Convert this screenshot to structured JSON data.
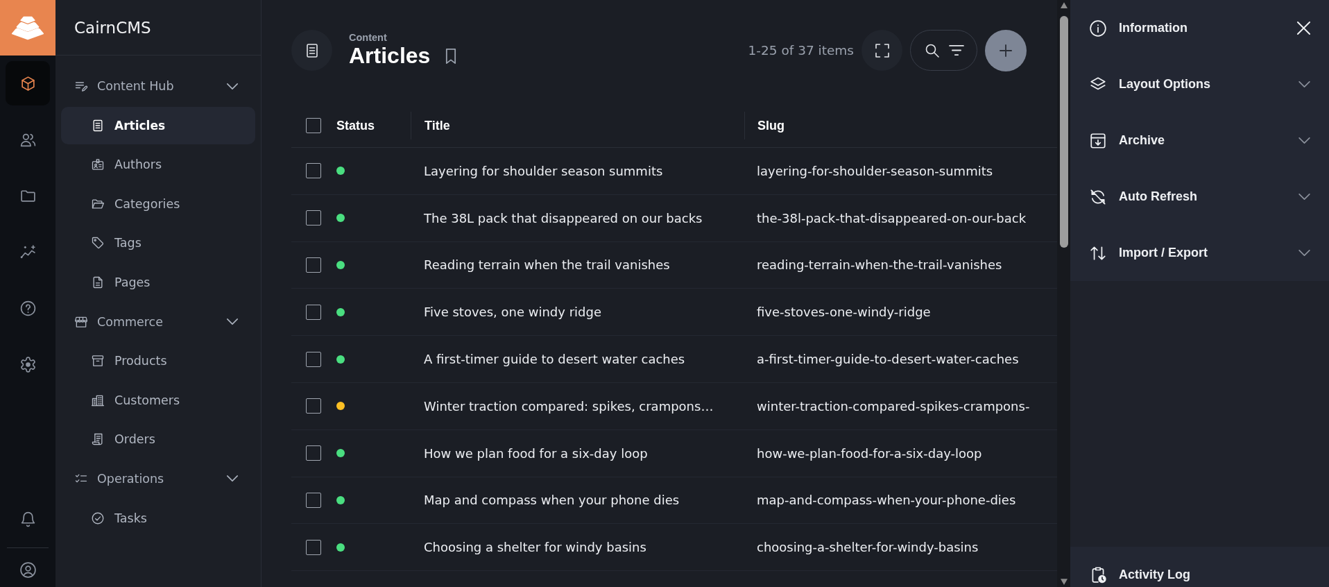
{
  "rail": {
    "items": [
      {
        "selected": true
      },
      {
        "selected": false
      },
      {
        "selected": false
      },
      {
        "selected": false
      },
      {
        "selected": false
      },
      {
        "selected": false
      }
    ]
  },
  "sidebar": {
    "brand": "CairnCMS",
    "groups": [
      {
        "label": "Content Hub",
        "expanded": true,
        "children": [
          {
            "label": "Articles",
            "selected": true
          },
          {
            "label": "Authors",
            "selected": false
          },
          {
            "label": "Categories",
            "selected": false
          },
          {
            "label": "Tags",
            "selected": false
          },
          {
            "label": "Pages",
            "selected": false
          }
        ]
      },
      {
        "label": "Commerce",
        "expanded": true,
        "children": [
          {
            "label": "Products",
            "selected": false
          },
          {
            "label": "Customers",
            "selected": false
          },
          {
            "label": "Orders",
            "selected": false
          }
        ]
      },
      {
        "label": "Operations",
        "expanded": true,
        "children": [
          {
            "label": "Tasks",
            "selected": false
          }
        ]
      }
    ]
  },
  "header": {
    "section": "Content",
    "title": "Articles",
    "count": "1-25 of 37 items"
  },
  "table": {
    "select_all": {
      "checked": false
    },
    "columns": [
      "Status",
      "Title",
      "Slug"
    ],
    "rows": [
      {
        "checked": false,
        "color": "#4ade80",
        "title": "Layering for shoulder season summits",
        "slug": "layering-for-shoulder-season-summits"
      },
      {
        "checked": false,
        "color": "#4ade80",
        "title": "The 38L pack that disappeared on our backs",
        "slug": "the-38l-pack-that-disappeared-on-our-back"
      },
      {
        "checked": false,
        "color": "#4ade80",
        "title": "Reading terrain when the trail vanishes",
        "slug": "reading-terrain-when-the-trail-vanishes"
      },
      {
        "checked": false,
        "color": "#4ade80",
        "title": "Five stoves, one windy ridge",
        "slug": "five-stoves-one-windy-ridge"
      },
      {
        "checked": false,
        "color": "#4ade80",
        "title": "A first-timer guide to desert water caches",
        "slug": "a-first-timer-guide-to-desert-water-caches"
      },
      {
        "checked": false,
        "color": "#fbbf24",
        "title": "Winter traction compared: spikes, crampons…",
        "slug": "winter-traction-compared-spikes-crampons-"
      },
      {
        "checked": false,
        "color": "#4ade80",
        "title": "How we plan food for a six-day loop",
        "slug": "how-we-plan-food-for-a-six-day-loop"
      },
      {
        "checked": false,
        "color": "#4ade80",
        "title": "Map and compass when your phone dies",
        "slug": "map-and-compass-when-your-phone-dies"
      },
      {
        "checked": false,
        "color": "#4ade80",
        "title": "Choosing a shelter for windy basins",
        "slug": "choosing-a-shelter-for-windy-basins"
      }
    ]
  },
  "panel": {
    "sections": [
      {
        "kind": "header",
        "label": "Information"
      },
      {
        "kind": "section",
        "label": "Layout Options",
        "expanded": false
      },
      {
        "kind": "section",
        "label": "Archive",
        "expanded": false
      },
      {
        "kind": "section",
        "label": "Auto Refresh",
        "expanded": false
      },
      {
        "kind": "section",
        "label": "Import / Export",
        "expanded": false
      }
    ],
    "footer": {
      "label": "Activity Log"
    }
  }
}
